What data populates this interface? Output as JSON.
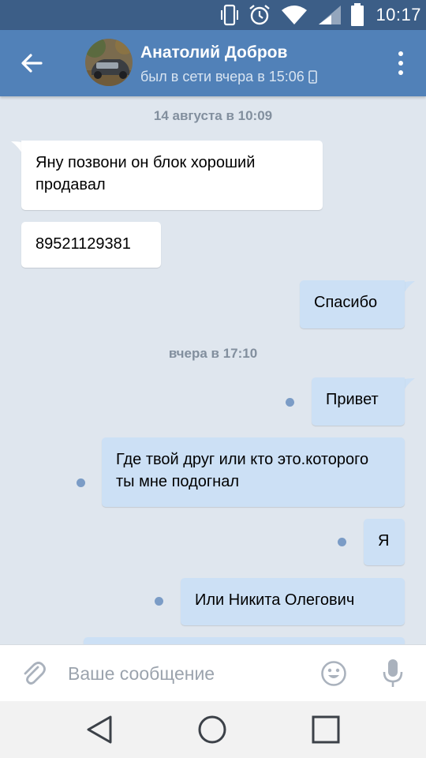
{
  "status_bar": {
    "time": "10:17",
    "icons": [
      "vibrate-icon",
      "alarm-icon",
      "wifi-icon",
      "signal-icon",
      "battery-icon"
    ]
  },
  "header": {
    "contact_name": "Анатолий Добров",
    "last_seen": "был в сети вчера в 15:06",
    "last_seen_device_icon": "phone-icon"
  },
  "messages": {
    "date1": "14 августа в 10:09",
    "m1": "Яну позвони он блок хороший продавал",
    "m2": "89521129381",
    "m3": "Спасибо",
    "date2": "вчера в 17:10",
    "m4": "Привет",
    "m5": "Где твой друг или кто это.которого ты мне подогнал",
    "m6": "Я",
    "m7": "Или Никита Олегович"
  },
  "composer": {
    "placeholder": "Ваше сообщение",
    "attach_icon": "paperclip-icon",
    "emoji_icon": "smiley-icon",
    "mic_icon": "microphone-icon"
  },
  "colors": {
    "header": "#5181b8",
    "status_bar": "#3c5e87",
    "chat_bg": "#dfe6ee",
    "incoming_bubble": "#ffffff",
    "outgoing_bubble": "#cce0f5",
    "unread_dot": "#7b9cc6"
  }
}
